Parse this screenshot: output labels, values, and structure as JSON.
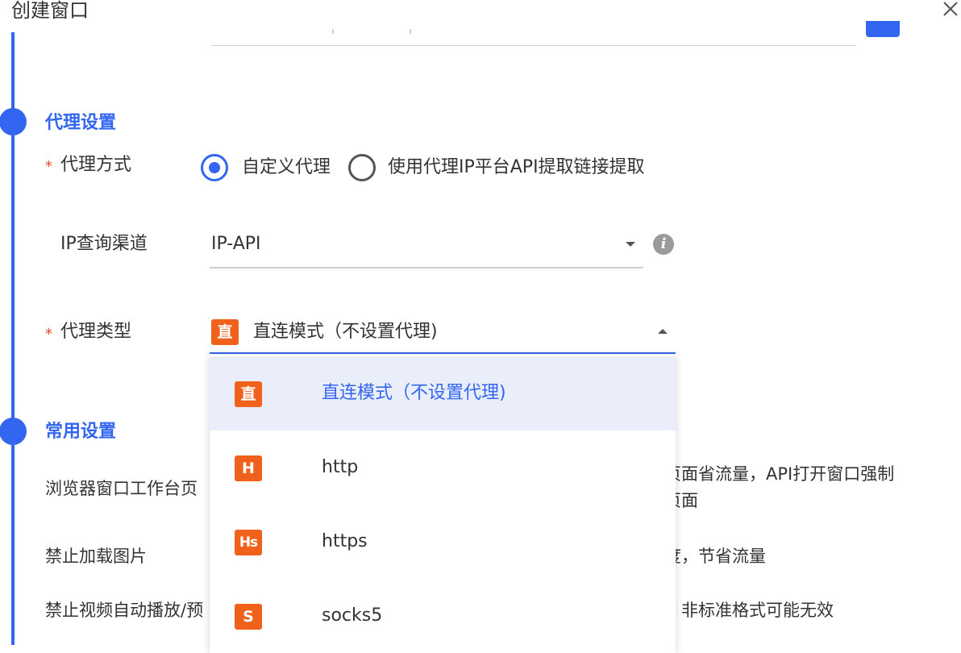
{
  "dialog": {
    "title": "创建窗口",
    "close_icon": "close-icon"
  },
  "theme": {
    "accent": "#3366f0",
    "badge": "#f0621c",
    "required": "#e6492d",
    "selected_bg": "#eaeefb"
  },
  "proxy_section": {
    "title": "代理设置",
    "method": {
      "required_mark": "*",
      "label": "代理方式",
      "options": [
        {
          "label": "自定义代理",
          "checked": true
        },
        {
          "label": "使用代理IP平台API提取链接提取",
          "checked": false
        }
      ]
    },
    "ip_channel": {
      "label": "IP查询渠道",
      "value": "IP-API",
      "info_icon": "info-icon",
      "info_glyph": "i"
    },
    "proxy_type": {
      "required_mark": "*",
      "label": "代理类型",
      "value": "直连模式（不设置代理)",
      "value_badge": "直",
      "expanded": true,
      "options": [
        {
          "badge": "直",
          "label": "直连模式（不设置代理)",
          "selected": true
        },
        {
          "badge": "H",
          "label": "http",
          "selected": false
        },
        {
          "badge": "Hs",
          "label": "https",
          "selected": false
        },
        {
          "badge": "S",
          "label": "socks5",
          "selected": false
        }
      ]
    }
  },
  "common_section": {
    "title": "常用设置",
    "rows": [
      {
        "label": "浏览器窗口工作台页",
        "desc_line1": "页面省流量，API打开窗口强制",
        "desc_line2": "页面"
      },
      {
        "label": "禁止加载图片",
        "desc_line1": "度，节省流量"
      },
      {
        "label": "禁止视频自动播放/预",
        "desc_line1": "，非标准格式可能无效"
      }
    ]
  }
}
